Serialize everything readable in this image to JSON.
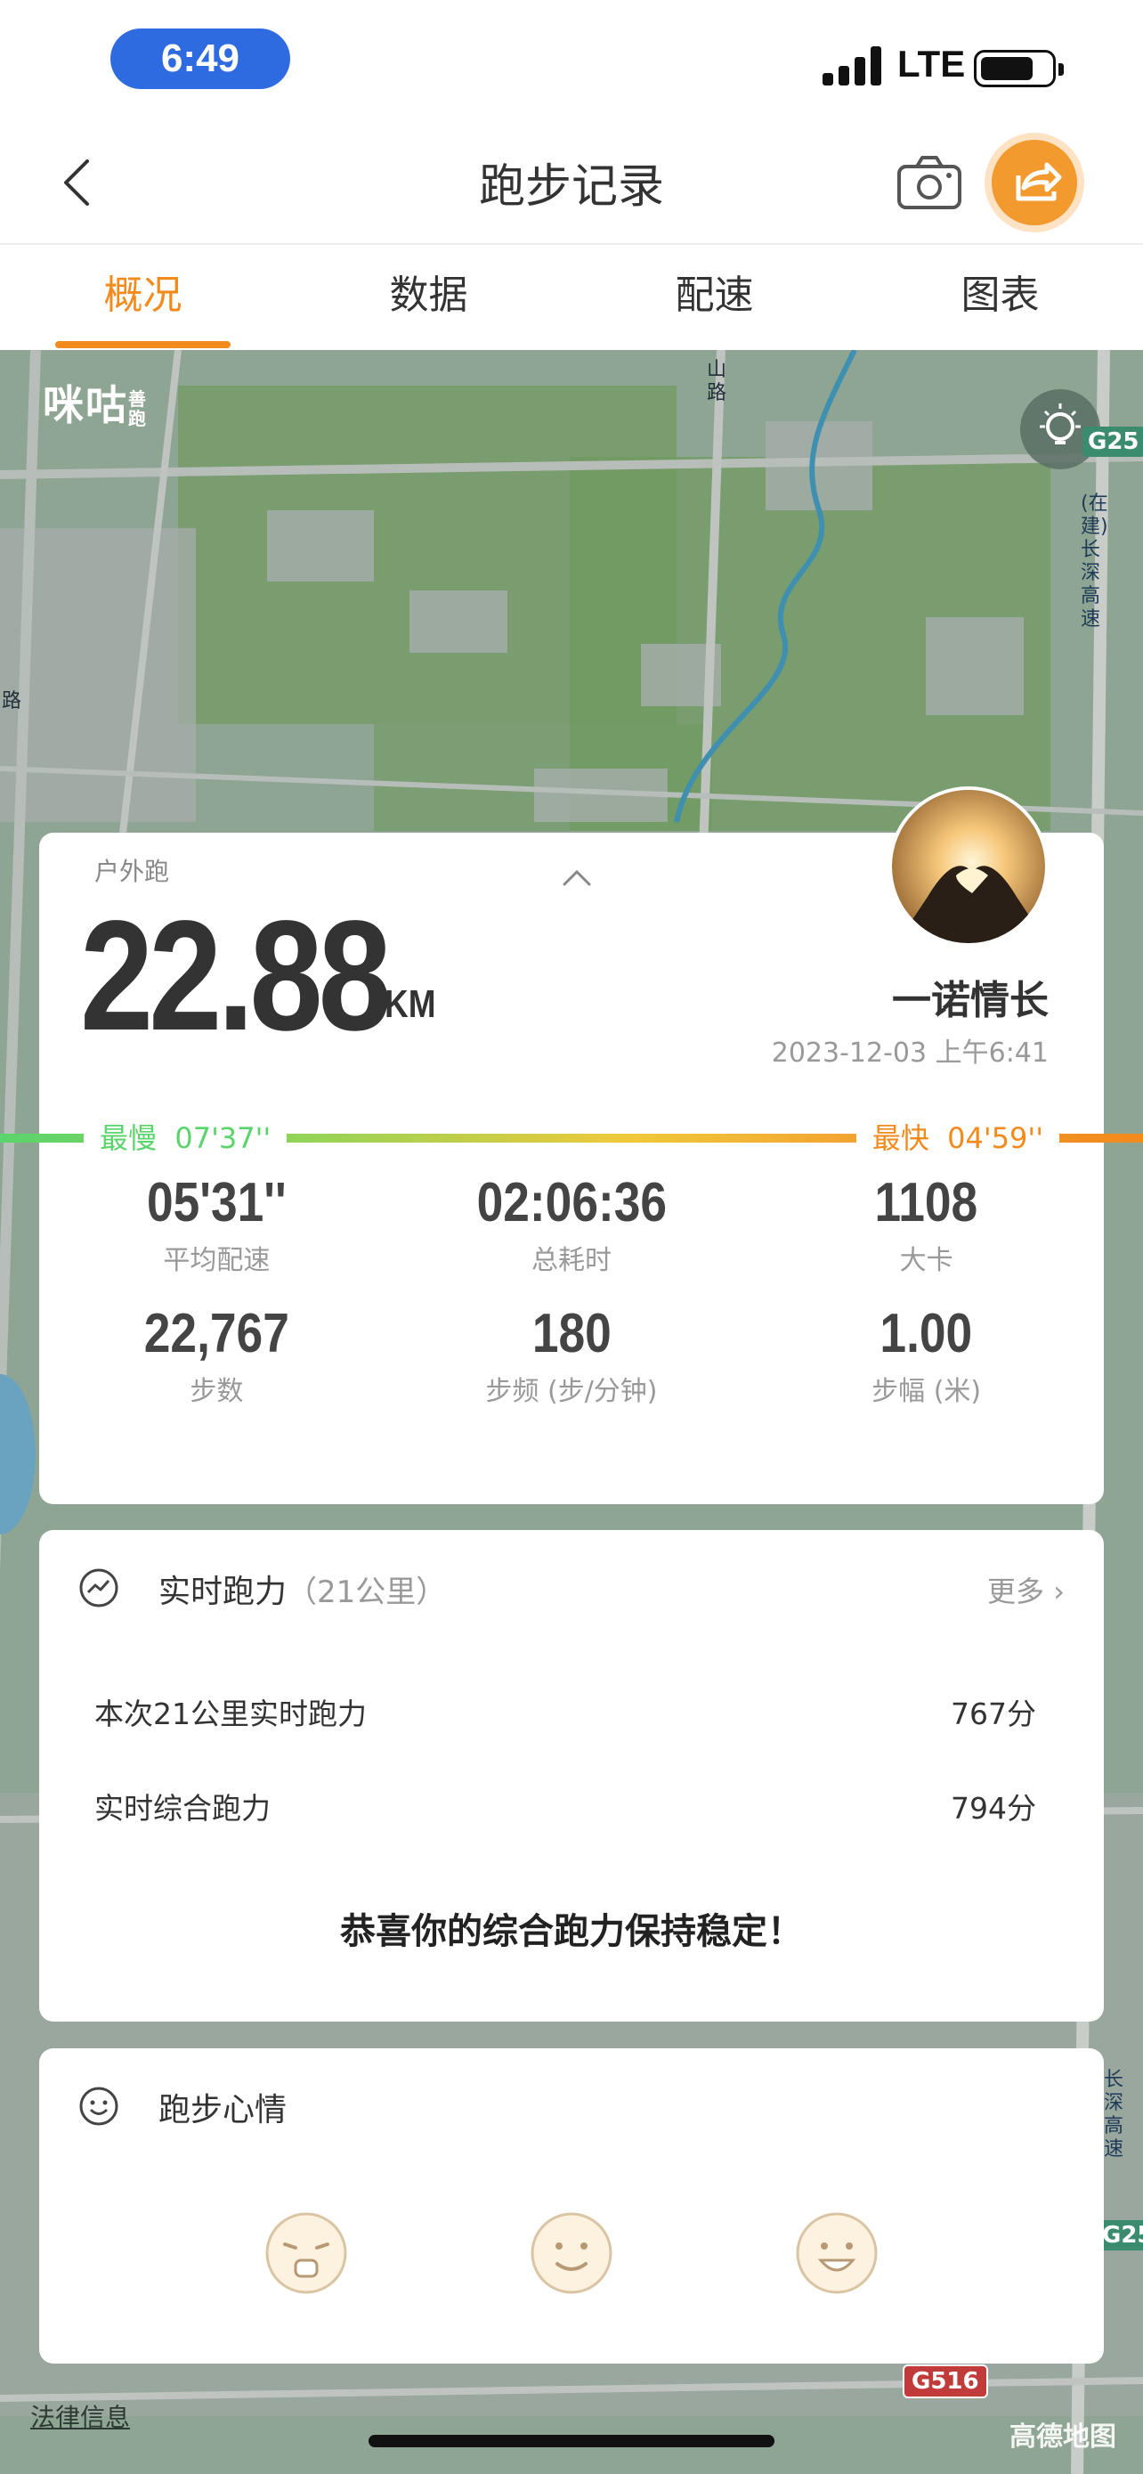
{
  "status": {
    "time": "6:49",
    "network": "LTE"
  },
  "nav": {
    "title": "跑步记录"
  },
  "tabs": [
    {
      "label": "概况"
    },
    {
      "label": "数据"
    },
    {
      "label": "配速"
    },
    {
      "label": "图表"
    }
  ],
  "map": {
    "logo": "咪咕",
    "logo_sub": "善跑",
    "legal": "法律信息",
    "provider": "高德地图",
    "road_labels": [
      "G25",
      "(在建)长深高速",
      "长深高速",
      "G25",
      "G516",
      "山路",
      "路"
    ]
  },
  "summary": {
    "sport_type": "户外跑",
    "distance": "22.88",
    "unit": "KM",
    "username": "一诺情长",
    "datetime": "2023-12-03 上午6:41",
    "slowest_label": "最慢",
    "slowest_pace": "07'37''",
    "fastest_label": "最快",
    "fastest_pace": "04'59''",
    "stats": [
      {
        "value": "05'31''",
        "label": "平均配速"
      },
      {
        "value": "02:06:36",
        "label": "总耗时"
      },
      {
        "value": "1108",
        "label": "大卡"
      },
      {
        "value": "22,767",
        "label": "步数"
      },
      {
        "value": "180",
        "label": "步频 (步/分钟)"
      },
      {
        "value": "1.00",
        "label": "步幅 (米)"
      }
    ]
  },
  "ability": {
    "title": "实时跑力",
    "subtitle": "（21公里）",
    "more": "更多",
    "rows": [
      {
        "label": "本次21公里实时跑力",
        "value": "767分"
      },
      {
        "label": "实时综合跑力",
        "value": "794分"
      }
    ],
    "message": "恭喜你的综合跑力保持稳定！"
  },
  "mood": {
    "title": "跑步心情"
  },
  "colors": {
    "accent": "#f28a1c",
    "slow": "#5bd46b",
    "map_bg": "#7f9a86"
  }
}
